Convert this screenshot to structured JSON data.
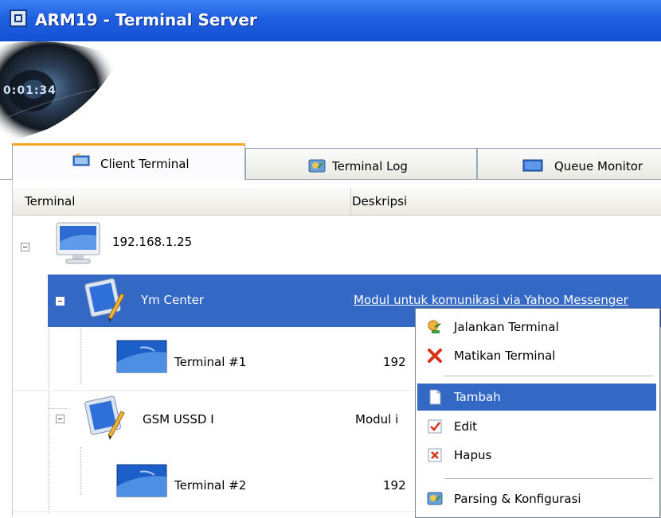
{
  "window": {
    "title": "ARM19 - Terminal Server"
  },
  "banner": {
    "timer": "0:01:34"
  },
  "tabs": [
    {
      "label": "Client Terminal",
      "icon": "client-terminal-icon",
      "active": true
    },
    {
      "label": "Terminal Log",
      "icon": "terminal-log-icon",
      "active": false
    },
    {
      "label": "Queue Monitor",
      "icon": "queue-monitor-icon",
      "active": false
    }
  ],
  "table": {
    "columns": [
      "Terminal",
      "Deskripsi"
    ],
    "rows": [
      {
        "name": "192.168.1.25",
        "desc": "",
        "icon": "computer-icon",
        "level": 0
      },
      {
        "name": "Ym Center",
        "desc": "Modul untuk komunikasi via Yahoo Messenger",
        "icon": "module-icon",
        "level": 1,
        "selected": true
      },
      {
        "name": "Terminal #1",
        "desc": "192",
        "icon": "terminal-icon",
        "level": 2
      },
      {
        "name": "GSM USSD I",
        "desc": "Modul i",
        "icon": "module-icon",
        "level": 1
      },
      {
        "name": "Terminal #2",
        "desc": "192",
        "icon": "terminal-icon",
        "level": 2
      }
    ]
  },
  "context_menu": {
    "items": [
      {
        "label": "Jalankan Terminal",
        "icon": "run-terminal-icon"
      },
      {
        "label": "Matikan Terminal",
        "icon": "stop-terminal-icon"
      },
      {
        "label": "Tambah",
        "icon": "add-page-icon",
        "highlighted": true
      },
      {
        "label": "Edit",
        "icon": "edit-icon"
      },
      {
        "label": "Hapus",
        "icon": "delete-icon"
      },
      {
        "label": "Parsing & Konfigurasi",
        "icon": "config-icon"
      }
    ]
  },
  "colors": {
    "titlebar": "#1f5fe0",
    "selection": "#3368c5",
    "active_tab_accent": "#f5a623"
  }
}
